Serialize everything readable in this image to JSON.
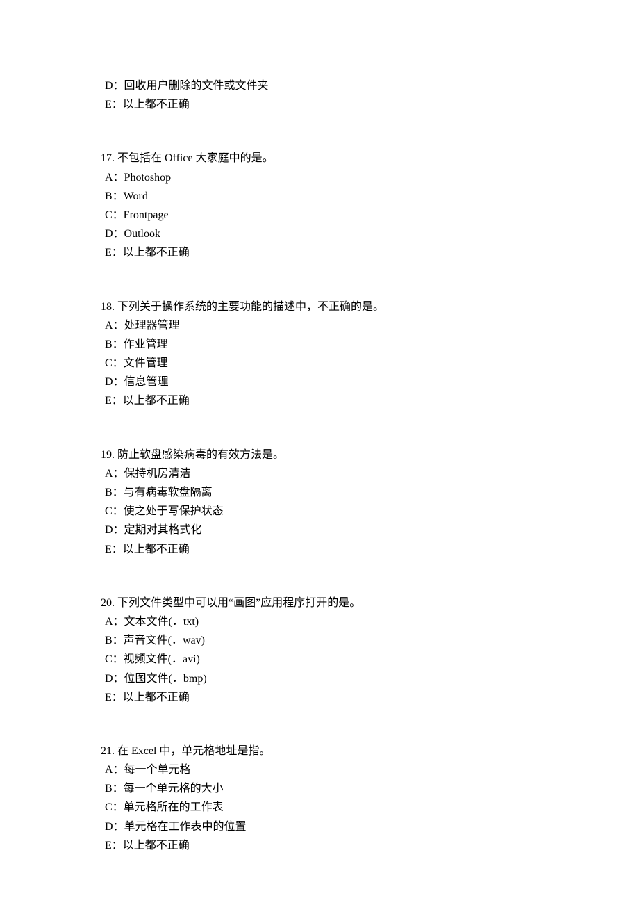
{
  "orphan": {
    "options": [
      "D：回收用户删除的文件或文件夹",
      "E：以上都不正确"
    ]
  },
  "questions": [
    {
      "stem": "17.  不包括在 Office 大家庭中的是。",
      "options": [
        "A：Photoshop",
        "B：Word",
        "C：Frontpage",
        "D：Outlook",
        "E：以上都不正确"
      ]
    },
    {
      "stem": "18. 下列关于操作系统的主要功能的描述中，不正确的是。",
      "options": [
        "A：处理器管理",
        "B：作业管理",
        "C：文件管理",
        "D：信息管理",
        "E：以上都不正确"
      ]
    },
    {
      "stem": "19. 防止软盘感染病毒的有效方法是。",
      "options": [
        "A：保持机房清洁",
        "B：与有病毒软盘隔离",
        "C：使之处于写保护状态",
        "D：定期对其格式化",
        "E：以上都不正确"
      ]
    },
    {
      "stem": "20. 下列文件类型中可以用“画图”应用程序打开的是。",
      "options": [
        "A：文本文件(．txt)",
        "B：声音文件(．wav)",
        "C：视频文件(．avi)",
        "D：位图文件(．bmp)",
        "E：以上都不正确"
      ]
    },
    {
      "stem": "21. 在 Excel 中，单元格地址是指。",
      "options": [
        "A：每一个单元格",
        "B：每一个单元格的大小",
        "C：单元格所在的工作表",
        "D：单元格在工作表中的位置",
        "E：以上都不正确"
      ]
    }
  ]
}
